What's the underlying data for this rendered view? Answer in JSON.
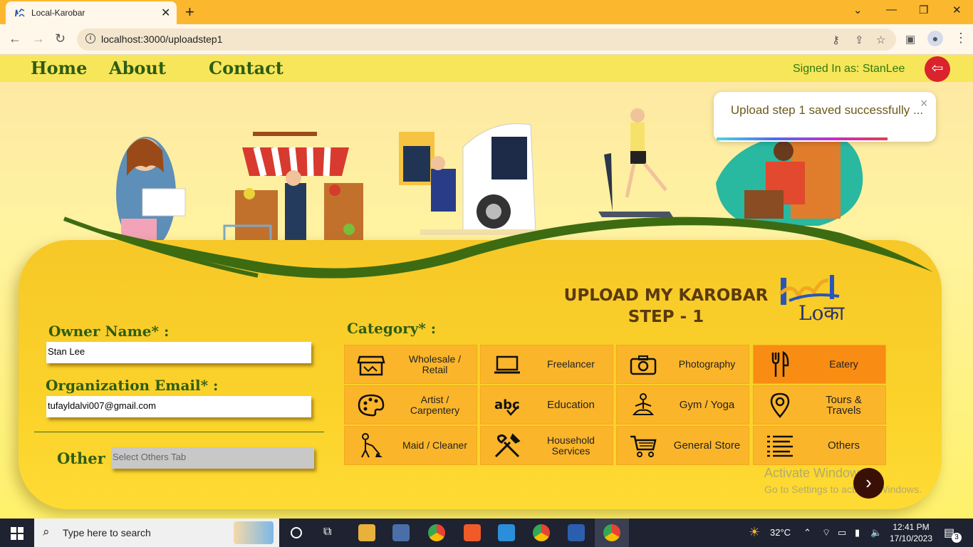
{
  "browser": {
    "tab_title": "Local-Karobar",
    "url": "localhost:3000/uploadstep1"
  },
  "nav": {
    "home": "Home",
    "about": "About",
    "contact": "Contact",
    "signed_in": "Signed In as: StanLee"
  },
  "toast": {
    "message": "Upload step 1 saved successfully ..."
  },
  "form": {
    "title_line1": "UPLOAD MY KAROBAR",
    "title_line2": "STEP - 1",
    "owner_label": "Owner Name* :",
    "owner_value": "Stan Lee",
    "email_label": "Organization Email* :",
    "email_value": "tufayldalvi007@gmail.com",
    "other_label": "Other :",
    "other_placeholder": "Select Others Tab",
    "category_label": "Category* :",
    "logo_text": "Loका"
  },
  "categories": [
    {
      "label": "Wholesale / Retail",
      "icon": "shop-icon"
    },
    {
      "label": "Freelancer",
      "icon": "laptop-icon"
    },
    {
      "label": "Photography",
      "icon": "camera-icon"
    },
    {
      "label": "Eatery",
      "icon": "fork-knife-icon",
      "selected": true
    },
    {
      "label": "Artist / Carpentery",
      "icon": "palette-icon"
    },
    {
      "label": "Education",
      "icon": "abc-icon"
    },
    {
      "label": "Gym / Yoga",
      "icon": "yoga-icon"
    },
    {
      "label": "Tours & Travels",
      "icon": "map-pin-icon"
    },
    {
      "label": "Maid / Cleaner",
      "icon": "cleaner-icon"
    },
    {
      "label": "Household Services",
      "icon": "tools-icon"
    },
    {
      "label": "General Store",
      "icon": "cart-icon"
    },
    {
      "label": "Others",
      "icon": "list-icon"
    }
  ],
  "watermark": {
    "line1": "Activate Windows",
    "line2": "Go to Settings to activate Windows."
  },
  "taskbar": {
    "search_placeholder": "Type here to search",
    "temperature": "32°C",
    "time": "12:41 PM",
    "date": "17/10/2023",
    "notifications": "3"
  }
}
